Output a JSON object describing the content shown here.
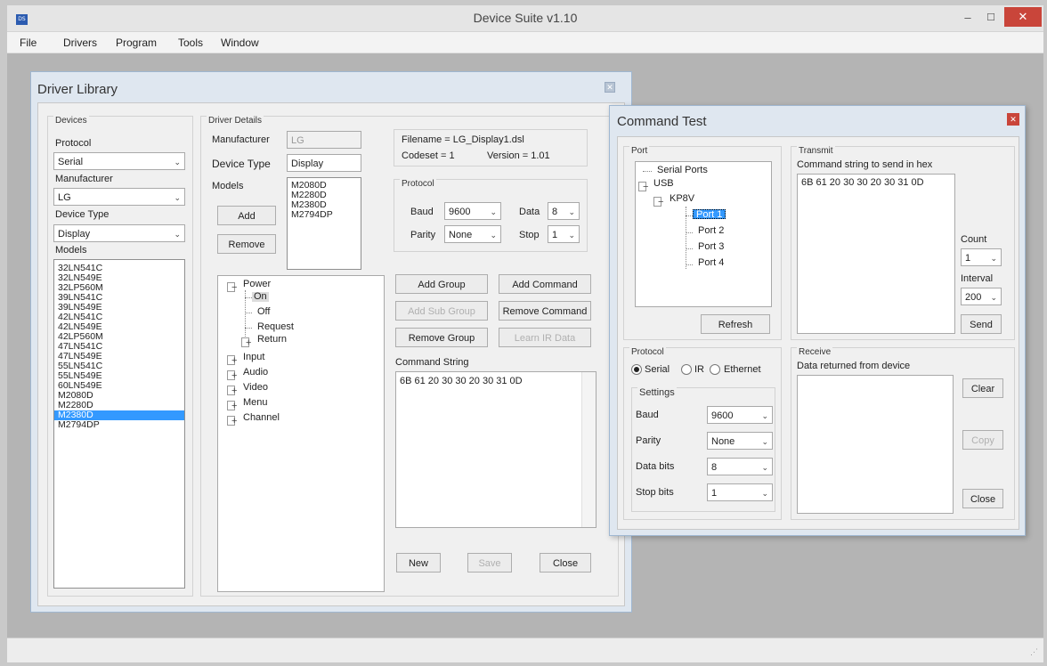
{
  "app": {
    "title": "Device Suite v1.10",
    "icon_label": "DS",
    "minimize": "–",
    "maximize": "☐",
    "close": "✕"
  },
  "menu": [
    "File",
    "Drivers",
    "Program",
    "Tools",
    "Window"
  ],
  "driver_library": {
    "title": "Driver Library",
    "devices": {
      "label": "Devices",
      "protocol_label": "Protocol",
      "protocol": "Serial",
      "manufacturer_label": "Manufacturer",
      "manufacturer": "LG",
      "device_type_label": "Device Type",
      "device_type": "Display",
      "models_label": "Models",
      "models": [
        "32LN541C",
        "32LN549E",
        "32LP560M",
        "39LN541C",
        "39LN549E",
        "42LN541C",
        "42LN549E",
        "42LP560M",
        "47LN541C",
        "47LN549E",
        "55LN541C",
        "55LN549E",
        "60LN549E",
        "M2080D",
        "M2280D",
        "M2380D",
        "M2794DP"
      ],
      "selected_model": "M2380D"
    },
    "details": {
      "label": "Driver Details",
      "manufacturer_label": "Manufacturer",
      "manufacturer": "LG",
      "device_type_label": "Device Type",
      "device_type": "Display",
      "models_label": "Models",
      "models": [
        "M2080D",
        "M2280D",
        "M2380D",
        "M2794DP"
      ],
      "add": "Add",
      "remove": "Remove",
      "filename": "Filename = LG_Display1.dsl",
      "codeset": "Codeset = 1",
      "version": "Version = 1.01",
      "protocol_label": "Protocol",
      "baud_label": "Baud",
      "baud": "9600",
      "data_label": "Data",
      "data": "8",
      "parity_label": "Parity",
      "parity": "None",
      "stop_label": "Stop",
      "stop": "1",
      "tree": {
        "power": "Power",
        "on": "On",
        "off": "Off",
        "request": "Request",
        "return": "Return",
        "input": "Input",
        "audio": "Audio",
        "video": "Video",
        "menu": "Menu",
        "channel": "Channel"
      },
      "add_group": "Add Group",
      "add_command": "Add Command",
      "add_sub_group": "Add Sub Group",
      "remove_command": "Remove Command",
      "remove_group": "Remove Group",
      "learn_ir": "Learn IR Data",
      "command_string_label": "Command String",
      "command_string": "6B 61 20 30 30 20 30 31 0D",
      "new": "New",
      "save": "Save",
      "close": "Close"
    }
  },
  "command_test": {
    "title": "Command Test",
    "port_label": "Port",
    "tree": {
      "serial_ports": "Serial Ports",
      "usb": "USB",
      "device": "KP8V",
      "ports": [
        "Port 1",
        "Port 2",
        "Port 3",
        "Port 4"
      ]
    },
    "refresh": "Refresh",
    "transmit_label": "Transmit",
    "transmit_hint": "Command string to send in hex",
    "transmit_value": "6B 61 20 30 30 20 30 31 0D",
    "count_label": "Count",
    "count": "1",
    "interval_label": "Interval",
    "interval": "200",
    "send": "Send",
    "protocol_label": "Protocol",
    "radios": [
      "Serial",
      "IR",
      "Ethernet"
    ],
    "settings_label": "Settings",
    "baud_label": "Baud",
    "baud": "9600",
    "parity_label": "Parity",
    "parity": "None",
    "databits_label": "Data bits",
    "databits": "8",
    "stopbits_label": "Stop bits",
    "stopbits": "1",
    "receive_label": "Receive",
    "receive_hint": "Data returned from device",
    "clear": "Clear",
    "copy": "Copy",
    "close": "Close"
  }
}
